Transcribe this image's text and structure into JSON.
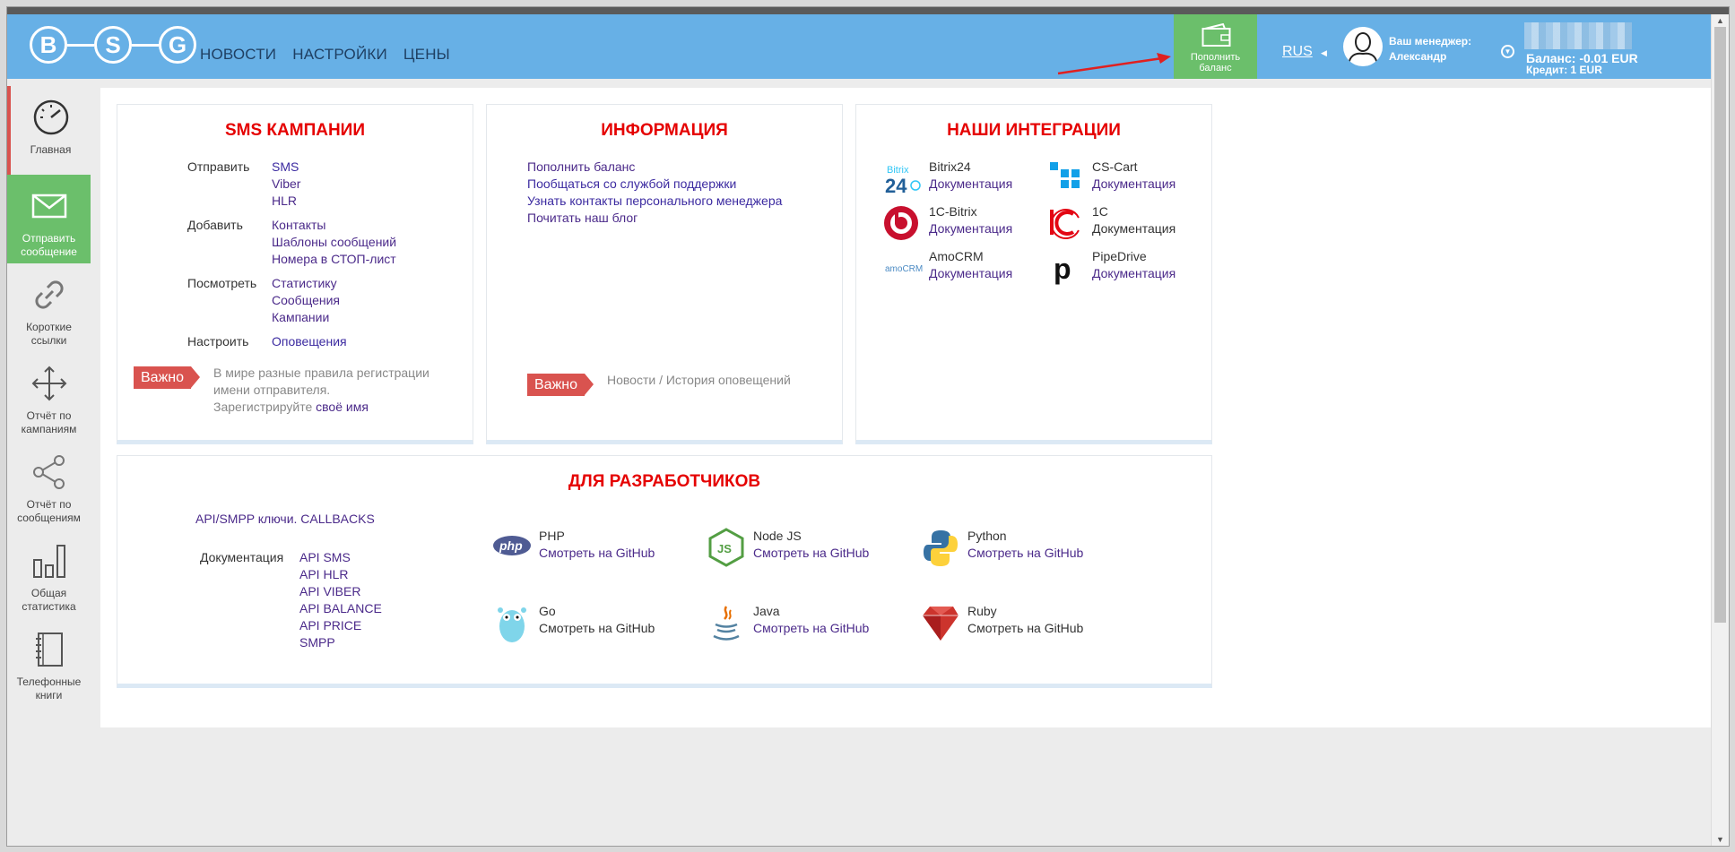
{
  "header": {
    "logo_letters": [
      "B",
      "S",
      "G"
    ],
    "nav": [
      "НОВОСТИ",
      "НАСТРОЙКИ",
      "ЦЕНЫ"
    ],
    "topup_line1": "Пополнить",
    "topup_line2": "баланс",
    "lang": "RUS",
    "manager_label": "Ваш менеджер:",
    "manager_name": "Александр",
    "balance": "Баланс: -0.01 EUR",
    "credit": "Кредит: 1 EUR"
  },
  "sidebar": {
    "items": [
      {
        "line1": "Главная",
        "line2": ""
      },
      {
        "line1": "Отправить",
        "line2": "сообщение"
      },
      {
        "line1": "Короткие",
        "line2": "ссылки"
      },
      {
        "line1": "Отчёт по",
        "line2": "кампаниям"
      },
      {
        "line1": "Отчёт по",
        "line2": "сообщениям"
      },
      {
        "line1": "Общая",
        "line2": "статистика"
      },
      {
        "line1": "Телефонные",
        "line2": "книги"
      }
    ]
  },
  "sms": {
    "title": "SMS КАМПАНИИ",
    "rows": [
      {
        "label": "Отправить",
        "links": [
          "SMS",
          "Viber",
          "HLR"
        ]
      },
      {
        "label": "Добавить",
        "links": [
          "Контакты",
          "Шаблоны сообщений",
          "Номера в СТОП-лист"
        ]
      },
      {
        "label": "Посмотреть",
        "links": [
          "Статистику",
          "Сообщения",
          "Кампании"
        ]
      },
      {
        "label": "Настроить",
        "links": [
          "Оповещения"
        ]
      }
    ],
    "important_badge": "Важно",
    "important_line1": "В мире разные правила регистрации",
    "important_line2": "имени отправителя.",
    "important_line3": "Зарегистрируйте",
    "important_link": "своё имя"
  },
  "info": {
    "title": "ИНФОРМАЦИЯ",
    "links": [
      "Пополнить баланс",
      "Пообщаться со службой поддержки",
      "Узнать контакты персонального менеджера",
      "Почитать наш блог"
    ],
    "badge": "Важно",
    "news": "Новости / История оповещений"
  },
  "integrations": {
    "title": "НАШИ ИНТЕГРАЦИИ",
    "items": [
      {
        "name": "Bitrix24",
        "doc": "Документация"
      },
      {
        "name": "CS-Cart",
        "doc": "Документация"
      },
      {
        "name": "1С-Bitrix",
        "doc": "Документация"
      },
      {
        "name": "1С",
        "doc": "Документация"
      },
      {
        "name": "AmoCRM",
        "doc": "Документация"
      },
      {
        "name": "PipeDrive",
        "doc": "Документация"
      }
    ]
  },
  "dev": {
    "title": "ДЛЯ РАЗРАБОТЧИКОВ",
    "api_keys": "API/SMPP ключи. CALLBACKS",
    "docs_label": "Документация",
    "docs": [
      "API SMS",
      "API HLR",
      "API VIBER",
      "API BALANCE",
      "API PRICE",
      "SMPP"
    ],
    "sdks": [
      {
        "name": "PHP",
        "gh": "Смотреть на GitHub"
      },
      {
        "name": "Node JS",
        "gh": "Смотреть на GitHub"
      },
      {
        "name": "Python",
        "gh": "Смотреть на GitHub"
      },
      {
        "name": "Go",
        "gh": "Смотреть на GitHub"
      },
      {
        "name": "Java",
        "gh": "Смотреть на GitHub"
      },
      {
        "name": "Ruby",
        "gh": "Смотреть на GitHub"
      }
    ]
  },
  "colors": {
    "header": "#67b0e6",
    "topup": "#6bbf6b",
    "title_red": "#e50000",
    "badge": "#d9534f",
    "link": "#3b2aa0"
  }
}
